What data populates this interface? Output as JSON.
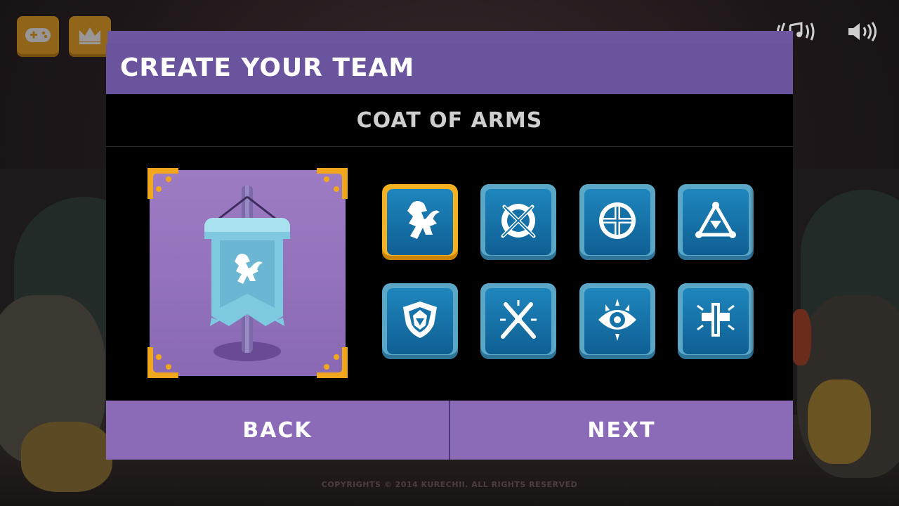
{
  "header": {
    "title": "CREATE YOUR TEAM"
  },
  "subheader": {
    "title": "COAT OF ARMS"
  },
  "top_bar": {
    "left_buttons": [
      {
        "icon": "gamepad-icon"
      },
      {
        "icon": "crown-icon"
      }
    ],
    "right_buttons": [
      {
        "icon": "music-icon"
      },
      {
        "icon": "speaker-icon"
      }
    ]
  },
  "preview": {
    "banner_emblem": "lion-icon",
    "banner_color": "#7cc9e0"
  },
  "emblems": [
    {
      "icon": "lion-icon",
      "selected": true
    },
    {
      "icon": "crossed-swords-shield-icon",
      "selected": false
    },
    {
      "icon": "cross-circle-icon",
      "selected": false
    },
    {
      "icon": "triangle-compass-icon",
      "selected": false
    },
    {
      "icon": "helmet-shield-icon",
      "selected": false
    },
    {
      "icon": "crossed-swords-burst-icon",
      "selected": false
    },
    {
      "icon": "eye-icon",
      "selected": false
    },
    {
      "icon": "radiant-cross-icon",
      "selected": false
    }
  ],
  "footer": {
    "back_label": "BACK",
    "next_label": "NEXT"
  },
  "copyright": "COPYRIGHTS © 2014 KURECHII. ALL RIGHTS RESERVED",
  "colors": {
    "header": "#6a549e",
    "button": "#8b6ab7",
    "tile": "#1e86bd",
    "selected": "#f4b223"
  }
}
